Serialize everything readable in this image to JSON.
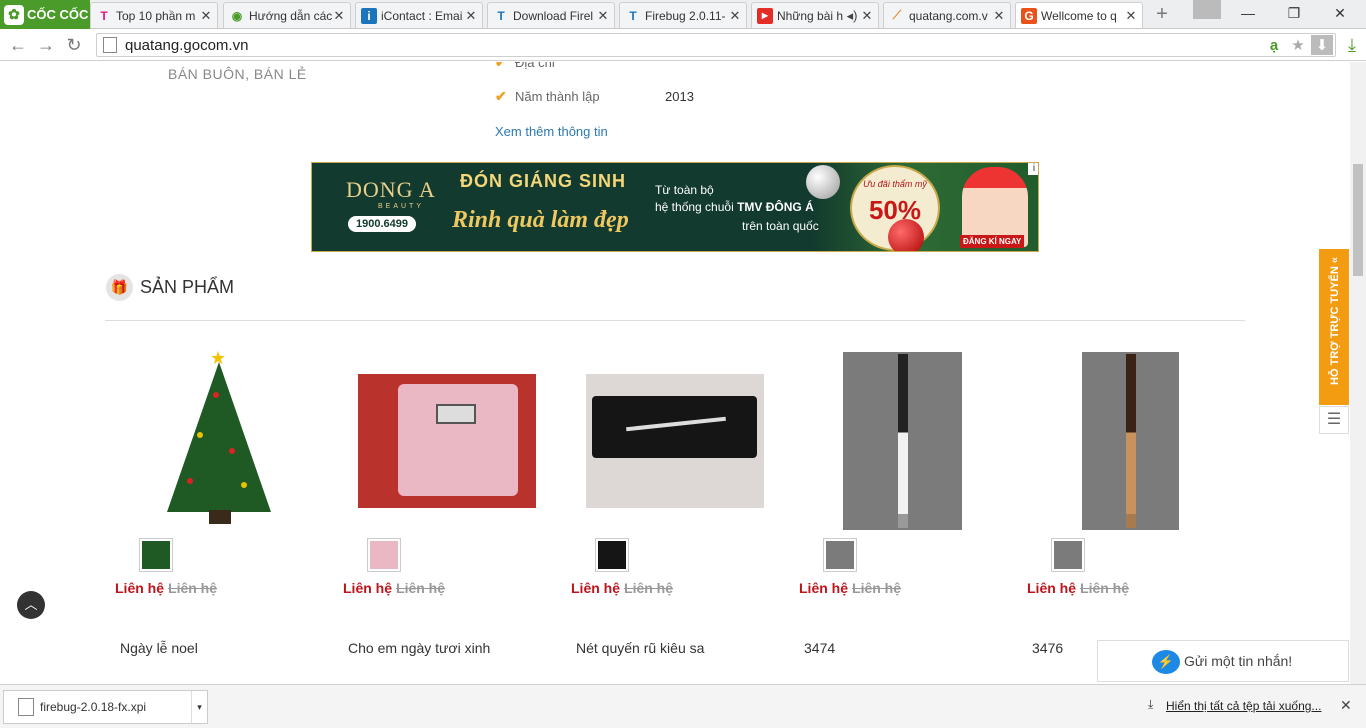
{
  "browser": {
    "brand": "CỐC CỐC",
    "tabs": [
      {
        "title": "Top 10 phần m",
        "icon": "T",
        "icon_color": "#e9177a"
      },
      {
        "title": "Hướng dẫn các",
        "icon": "◉",
        "icon_color": "#4b9b2a"
      },
      {
        "title": "iContact : Emai",
        "icon": "i",
        "icon_color": "#1c75bc"
      },
      {
        "title": "Download Firel",
        "icon": "T",
        "icon_color": "#1c75bc"
      },
      {
        "title": "Firebug 2.0.11-",
        "icon": "T",
        "icon_color": "#1c75bc"
      },
      {
        "title": "Những bài h",
        "icon": "▶",
        "icon_color": "#e52d27"
      },
      {
        "title": "quatang.com.v",
        "icon": "⟋",
        "icon_color": "#e98b2a"
      },
      {
        "title": "Wellcome to q",
        "icon": "G",
        "icon_color": "#e9531b",
        "active": true
      }
    ],
    "url": "quatang.gocom.vn"
  },
  "page": {
    "tagline": "BÁN BUÔN, BÁN LẺ",
    "info": [
      {
        "label": "Địa chỉ",
        "value": ""
      },
      {
        "label": "Năm thành lập",
        "value": "2013"
      }
    ],
    "more_info": "Xem thêm thông tin",
    "banner": {
      "brand": "DONG A",
      "brand_sub": "BEAUTY",
      "phone": "1900.6499",
      "title": "ĐÓN GIÁNG SINH",
      "slogan": "Rinh quà làm đẹp",
      "line1": "Từ toàn bộ",
      "line2a": "hệ thống chuỗi ",
      "line2b": "TMV ĐÔNG Á",
      "line3": "trên toàn quốc",
      "badge_text": "Ưu đãi thẩm mỹ",
      "badge_value": "50%",
      "register": "ĐĂNG KÍ NGAY",
      "info_mark": "i"
    },
    "section_title": "SẢN PHẨM",
    "products": [
      {
        "name": "Ngày lễ noel",
        "price": "Liên hệ",
        "old_price": "Liên hệ"
      },
      {
        "name": "Cho em ngày tươi xinh",
        "price": "Liên hệ",
        "old_price": "Liên hệ"
      },
      {
        "name": "Nét quyến rũ kiêu sa",
        "price": "Liên hệ",
        "old_price": "Liên hệ"
      },
      {
        "name": "3474",
        "price": "Liên hệ",
        "old_price": "Liên hệ"
      },
      {
        "name": "3476",
        "price": "Liên hệ",
        "old_price": "Liên hệ"
      }
    ],
    "support_tab": "HỖ TRỢ TRỰC TUYẾN «",
    "messenger": "Gửi một tin nhắn!"
  },
  "downloads": {
    "file": "firebug-2.0.18-fx.xpi",
    "show_all": "Hiển thị tất cả tệp tải xuống..."
  }
}
